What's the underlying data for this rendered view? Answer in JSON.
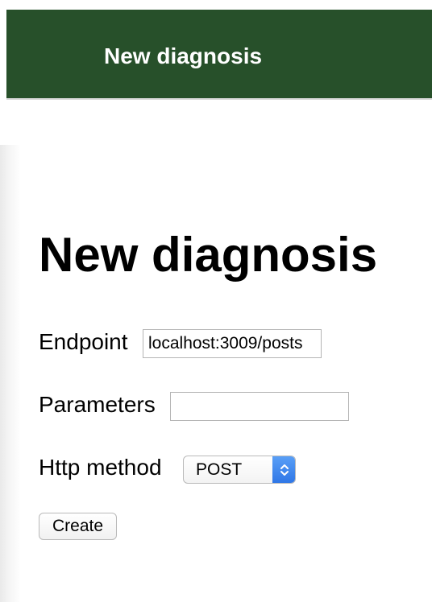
{
  "header": {
    "title": "New diagnosis",
    "background": "#27502a"
  },
  "main": {
    "title": "New diagnosis"
  },
  "form": {
    "endpoint": {
      "label": "Endpoint",
      "value": "localhost:3009/posts"
    },
    "parameters": {
      "label": "Parameters",
      "value": ""
    },
    "http_method": {
      "label": "Http method",
      "selected": "POST",
      "accent": "#2f76e6"
    },
    "submit_label": "Create"
  },
  "icons": {
    "select_arrows": "chevron-up-down-icon"
  }
}
